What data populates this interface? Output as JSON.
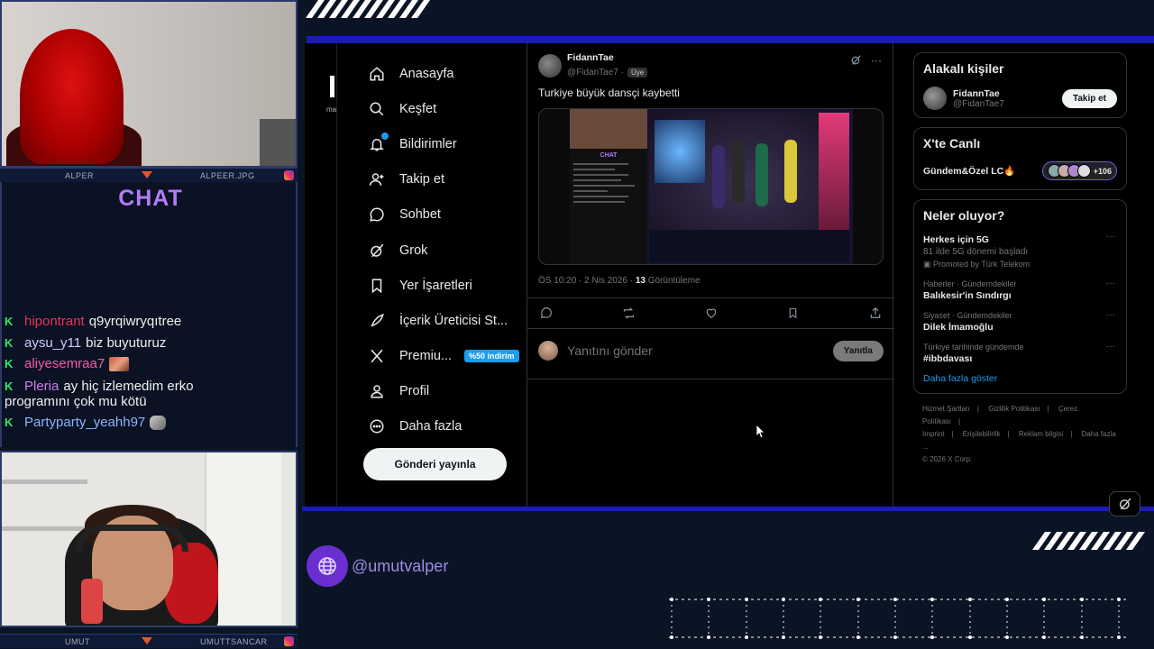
{
  "overlay": {
    "cam_top_left_name": "ALPER",
    "cam_top_right_name": "ALPEER.JPG",
    "cam_bottom_left_name": "UMUT",
    "cam_bottom_right_name": "UMUTTSANCAR",
    "chat_title": "CHAT",
    "handle": "@umutvalper",
    "accent_color": "#b27cf7",
    "bar_color": "#1a1ab8"
  },
  "chat": [
    {
      "user": "hipontrant",
      "user_color": "#e8315a",
      "message": "q9yrqiwryqıtree"
    },
    {
      "user": "aysu_y11",
      "user_color": "#d6c9ff",
      "message": "biz buyuturuz"
    },
    {
      "user": "aliyesemraa7",
      "user_color": "#ef5da8",
      "message": ""
    },
    {
      "user": "Pleria",
      "user_color": "#d07cf0",
      "message": "ay hiç izlemedim erko",
      "message_cont": "programını çok mu kötü"
    },
    {
      "user": "Partyparty_yeahh97",
      "user_color": "#8fb4ff",
      "message": ""
    }
  ],
  "x": {
    "left_stub_text": "ma",
    "nav": [
      {
        "label": "Anasayfa",
        "icon": "home-icon"
      },
      {
        "label": "Keşfet",
        "icon": "search-icon"
      },
      {
        "label": "Bildirimler",
        "icon": "bell-icon"
      },
      {
        "label": "Takip et",
        "icon": "person-add-icon"
      },
      {
        "label": "Sohbet",
        "icon": "chat-bubble-icon"
      },
      {
        "label": "Grok",
        "icon": "grok-icon"
      },
      {
        "label": "Yer İşaretleri",
        "icon": "bookmark-icon"
      },
      {
        "label": "İçerik Üreticisi St...",
        "icon": "rocket-icon"
      },
      {
        "label": "Premiu...",
        "icon": "x-logo-icon",
        "promo": "%50 indirim"
      },
      {
        "label": "Profil",
        "icon": "profile-icon"
      },
      {
        "label": "Daha fazla",
        "icon": "more-circle-icon"
      }
    ],
    "post_button": "Gönderi yayınla",
    "tweet": {
      "name": "FidannTae",
      "handle": "@FidanTae7 ·",
      "member_badge": "Üye",
      "text": "Turkiye büyük dansçi kaybetti",
      "meta_time": "ÖS 10:20 · 2 Nis 2026 ·",
      "meta_views_count": "13",
      "meta_views_label": "Görüntüleme",
      "media_chat_label": "CHAT",
      "reply_placeholder": "Yanıtını gönder",
      "reply_button": "Yanıtla"
    },
    "right": {
      "related_title": "Alakalı kişiler",
      "related_name": "FidannTae",
      "related_handle": "@FidanTae7",
      "follow_button": "Takip et",
      "live_title": "X'te Canlı",
      "live_name": "Gündem&Özel LC🔥",
      "live_count": "+106",
      "trends_title": "Neler oluyor?",
      "trends": [
        {
          "context": "",
          "title": "Herkes için 5G",
          "subtitle": "81 ilde 5G dönemi başladı",
          "promo": "Promoted by Türk Telekom"
        },
        {
          "context": "Haberler · Gündemdekiler",
          "title": "Balıkesir'in Sındırgı",
          "subtitle": "",
          "promo": ""
        },
        {
          "context": "Siyaset · Gündemdekiler",
          "title": "Dilek İmamoğlu",
          "subtitle": "",
          "promo": ""
        },
        {
          "context": "Türkiye tarihinde gündemde",
          "title": "#ibbdavası",
          "subtitle": "",
          "promo": ""
        }
      ],
      "show_more": "Daha fazla göster",
      "footer": [
        "Hizmet Şartları",
        "Gizlilik Politikası",
        "Çerez Politikası",
        "Imprint",
        "Erişilebilirlik",
        "Reklam bilgisi",
        "Daha fazla ...",
        "© 2026 X Corp."
      ]
    }
  }
}
